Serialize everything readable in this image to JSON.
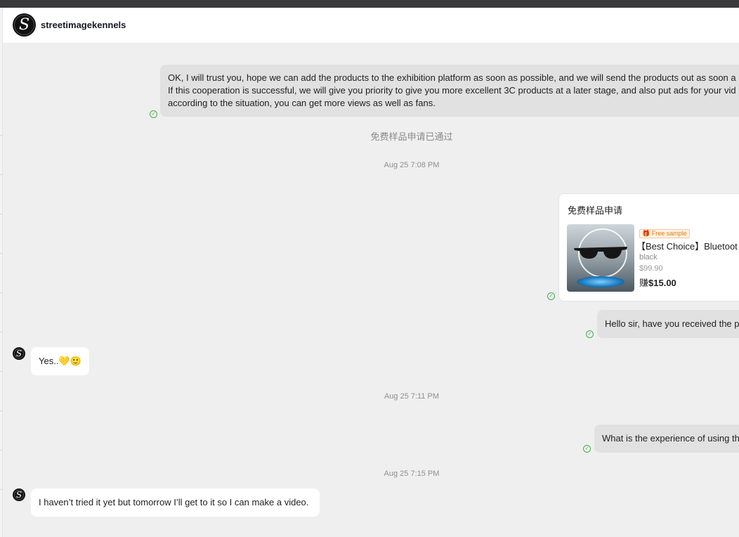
{
  "header": {
    "name": "streetimagekennels"
  },
  "messages": {
    "m1": {
      "line1": "OK, I will trust you, hope we can add the products to the exhibition platform as soon as possible, and we will send the products out as soon a",
      "line2": "If this cooperation is successful, we will give you priority to give you more excellent 3C products at a later stage, and also put ads for your vid",
      "line3": "according to the situation, you can get more views as well as fans."
    },
    "system1": "免费样品申请已通过",
    "time1": "Aug 25 7:08 PM",
    "sample_card": {
      "title": "免费样品申请",
      "badge": "Free sample",
      "product_name": "【Best Choice】Bluetoot",
      "variant": "black",
      "price": "$99.90",
      "earn_prefix": "赚",
      "earn_amount": "$15.00"
    },
    "m2": "Hello sir, have you received the p",
    "m3": "Yes..💛🙂",
    "time2": "Aug 25 7:11 PM",
    "m4": "What is the experience of using th",
    "time3": "Aug 25 7:15 PM",
    "m5": "I haven’t tried it yet but tomorrow I’ll get to it so I can make a video."
  },
  "avatar_glyph": "S",
  "colors": {
    "check": "#3cb34a",
    "badge": "#e07a12",
    "mine_bubble": "#e1e1e1"
  }
}
